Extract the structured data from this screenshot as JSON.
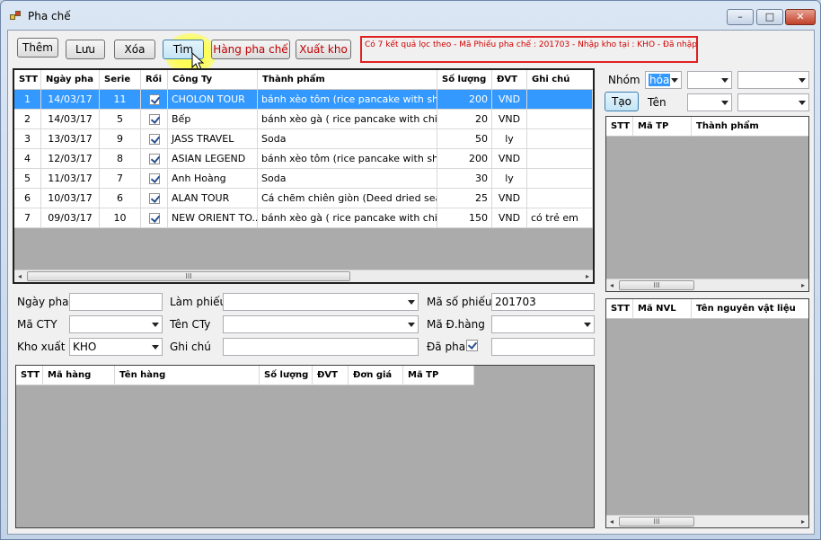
{
  "window": {
    "title": "Pha chế",
    "minimize": "–",
    "maximize": "□",
    "close": "✕"
  },
  "toolbar": {
    "them": "Thêm",
    "luu": "Lưu",
    "xoa": "Xóa",
    "tim": "Tìm",
    "hang_pha_che": "Hàng pha chế",
    "xuat_kho": "Xuất kho",
    "status": "Có 7 kết quả lọc theo  - Mã Phiếu pha chế : 201703 - Nhập kho tại : KHO - Đã nhập kho"
  },
  "main_grid": {
    "columns": [
      "STT",
      "Ngày pha",
      "Serie",
      "Rồi",
      "Công Ty",
      "Thành phẩm",
      "Số lượng",
      "ĐVT",
      "Ghi chú"
    ],
    "rows": [
      {
        "stt": "1",
        "ngay": "14/03/17",
        "serie": "11",
        "congty": "CHOLON TOUR",
        "thanhpham": "bánh xèo tôm (rice pancake with shri...",
        "soluong": "200",
        "dvt": "VND",
        "ghichu": ""
      },
      {
        "stt": "2",
        "ngay": "14/03/17",
        "serie": "5",
        "congty": "Bếp",
        "thanhpham": "bánh xèo gà ( rice pancake with chic...",
        "soluong": "20",
        "dvt": "VND",
        "ghichu": ""
      },
      {
        "stt": "3",
        "ngay": "13/03/17",
        "serie": "9",
        "congty": "JASS TRAVEL",
        "thanhpham": "Soda",
        "soluong": "50",
        "dvt": "ly",
        "ghichu": ""
      },
      {
        "stt": "4",
        "ngay": "12/03/17",
        "serie": "8",
        "congty": "ASIAN LEGEND",
        "thanhpham": "bánh xèo tôm (rice pancake with shri...",
        "soluong": "200",
        "dvt": "VND",
        "ghichu": ""
      },
      {
        "stt": "5",
        "ngay": "11/03/17",
        "serie": "7",
        "congty": "Anh Hoàng",
        "thanhpham": "Soda",
        "soluong": "30",
        "dvt": "ly",
        "ghichu": ""
      },
      {
        "stt": "6",
        "ngay": "10/03/17",
        "serie": "6",
        "congty": "ALAN TOUR",
        "thanhpham": "Cá chẽm chiên giòn (Deed dried seab...",
        "soluong": "25",
        "dvt": "VND",
        "ghichu": ""
      },
      {
        "stt": "7",
        "ngay": "09/03/17",
        "serie": "10",
        "congty": "NEW ORIENT TO...",
        "thanhpham": "bánh xèo gà ( rice pancake with chic...",
        "soluong": "150",
        "dvt": "VND",
        "ghichu": "có trẻ em"
      }
    ]
  },
  "form": {
    "ngay_pha_label": "Ngày pha",
    "ngay_pha": "",
    "lam_phieu_label": "Làm phiếu",
    "lam_phieu": "",
    "ma_so_phieu_label": "Mã số phiếu",
    "ma_so_phieu": "201703",
    "ma_cty_label": "Mã CTY",
    "ma_cty": "",
    "ten_cty_label": "Tên CTy",
    "ten_cty": "",
    "ma_dhang_label": "Mã Đ.hàng",
    "ma_dhang": "",
    "kho_xuat_label": "Kho xuất",
    "kho_xuat": "KHO",
    "ghi_chu_label": "Ghi chú",
    "ghi_chu": "",
    "da_pha_label": "Đã pha",
    "da_pha_extra": ""
  },
  "detail_grid": {
    "columns": [
      "STT",
      "Mã hàng",
      "Tên hàng",
      "Số lượng",
      "ĐVT",
      "Đơn giá",
      "Mã TP"
    ]
  },
  "right_panel": {
    "nhom_label": "Nhóm",
    "nhom_value": "hóa",
    "tao_button": "Tạo",
    "ten_label": "Tên",
    "tp_columns": [
      "STT",
      "Mã TP",
      "Thành phẩm"
    ],
    "nvl_columns": [
      "STT",
      "Mã NVL",
      "Tên nguyên vật liệu"
    ]
  },
  "scroll": {
    "thumb": "III",
    "left": "◂",
    "right": "▸"
  }
}
